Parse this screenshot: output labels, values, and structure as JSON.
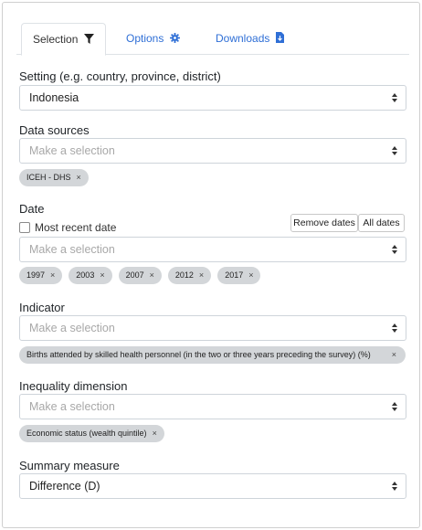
{
  "tabs": [
    {
      "label": "Selection",
      "icon": "filter-icon"
    },
    {
      "label": "Options",
      "icon": "gear-icon"
    },
    {
      "label": "Downloads",
      "icon": "file-download-icon"
    }
  ],
  "colors": {
    "accent": "#2f6fd6",
    "chip_bg": "#d3d6d9",
    "border": "#ced4da",
    "placeholder": "#a8a8a8"
  },
  "setting": {
    "label": "Setting (e.g. country, province, district)",
    "value": "Indonesia"
  },
  "data_sources": {
    "label": "Data sources",
    "placeholder": "Make a selection",
    "chips": [
      "ICEH - DHS"
    ]
  },
  "date": {
    "label": "Date",
    "most_recent_label": "Most recent date",
    "most_recent_checked": false,
    "remove_dates_label": "Remove dates",
    "all_dates_label": "All dates",
    "placeholder": "Make a selection",
    "chips": [
      "1997",
      "2003",
      "2007",
      "2012",
      "2017"
    ]
  },
  "indicator": {
    "label": "Indicator",
    "placeholder": "Make a selection",
    "chips": [
      "Births attended by skilled health personnel (in the two or three years preceding the survey) (%)"
    ]
  },
  "inequality": {
    "label": "Inequality dimension",
    "placeholder": "Make a selection",
    "chips": [
      "Economic status (wealth quintile)"
    ]
  },
  "summary": {
    "label": "Summary measure",
    "value": "Difference (D)"
  },
  "chip_remove_symbol": "×"
}
